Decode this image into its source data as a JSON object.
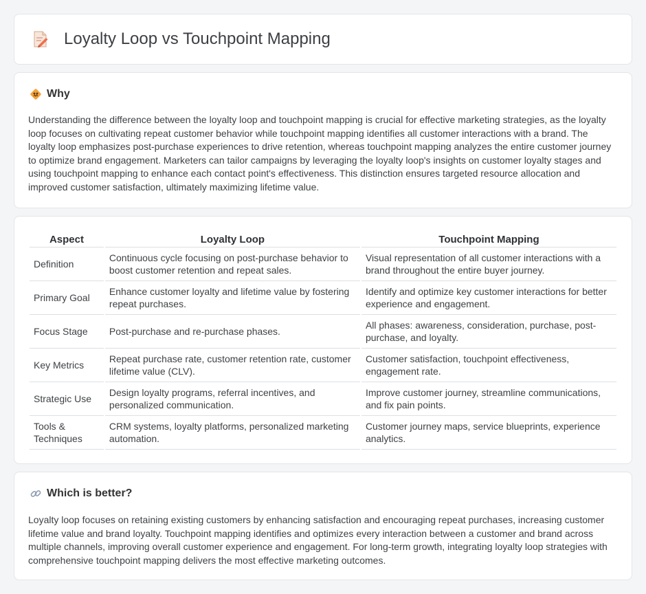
{
  "header": {
    "title": "Loyalty Loop vs Touchpoint Mapping",
    "icon": "document-pencil-icon"
  },
  "why": {
    "icon": "caution-sign-icon",
    "title": "Why",
    "body": "Understanding the difference between the loyalty loop and touchpoint mapping is crucial for effective marketing strategies, as the loyalty loop focuses on cultivating repeat customer behavior while touchpoint mapping identifies all customer interactions with a brand. The loyalty loop emphasizes post-purchase experiences to drive retention, whereas touchpoint mapping analyzes the entire customer journey to optimize brand engagement. Marketers can tailor campaigns by leveraging the loyalty loop's insights on customer loyalty stages and using touchpoint mapping to enhance each contact point's effectiveness. This distinction ensures targeted resource allocation and improved customer satisfaction, ultimately maximizing lifetime value."
  },
  "table": {
    "headers": [
      "Aspect",
      "Loyalty Loop",
      "Touchpoint Mapping"
    ],
    "rows": [
      [
        "Definition",
        "Continuous cycle focusing on post-purchase behavior to boost customer retention and repeat sales.",
        "Visual representation of all customer interactions with a brand throughout the entire buyer journey."
      ],
      [
        "Primary Goal",
        "Enhance customer loyalty and lifetime value by fostering repeat purchases.",
        "Identify and optimize key customer interactions for better experience and engagement."
      ],
      [
        "Focus Stage",
        "Post-purchase and re-purchase phases.",
        "All phases: awareness, consideration, purchase, post-purchase, and loyalty."
      ],
      [
        "Key Metrics",
        "Repeat purchase rate, customer retention rate, customer lifetime value (CLV).",
        "Customer satisfaction, touchpoint effectiveness, engagement rate."
      ],
      [
        "Strategic Use",
        "Design loyalty programs, referral incentives, and personalized communication.",
        "Improve customer journey, streamline communications, and fix pain points."
      ],
      [
        "Tools & Techniques",
        "CRM systems, loyalty platforms, personalized marketing automation.",
        "Customer journey maps, service blueprints, experience analytics."
      ]
    ]
  },
  "better": {
    "icon": "link-icon",
    "title": "Which is better?",
    "body": "Loyalty loop focuses on retaining existing customers by enhancing satisfaction and encouraging repeat purchases, increasing customer lifetime value and brand loyalty. Touchpoint mapping identifies and optimizes every interaction between a customer and brand across multiple channels, improving overall customer experience and engagement. For long-term growth, integrating loyalty loop strategies with comprehensive touchpoint mapping delivers the most effective marketing outcomes."
  },
  "colors": {
    "background": "#f4f5f7",
    "card": "#ffffff",
    "border": "#e3e5e8",
    "icon_orange": "#f4a23a"
  }
}
